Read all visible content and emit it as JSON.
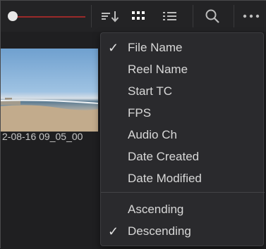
{
  "toolbar": {
    "icons": [
      "sort-icon",
      "grid-view-icon",
      "list-view-icon",
      "search-icon",
      "more-options-icon"
    ]
  },
  "clip": {
    "label": "2-08-16 09_05_00"
  },
  "sort_menu": {
    "fields": [
      {
        "label": "File Name",
        "checked": true
      },
      {
        "label": "Reel Name",
        "checked": false
      },
      {
        "label": "Start TC",
        "checked": false
      },
      {
        "label": "FPS",
        "checked": false
      },
      {
        "label": "Audio Ch",
        "checked": false
      },
      {
        "label": "Date Created",
        "checked": false
      },
      {
        "label": "Date Modified",
        "checked": false
      }
    ],
    "order": [
      {
        "label": "Ascending",
        "checked": false
      },
      {
        "label": "Descending",
        "checked": true
      }
    ],
    "check_glyph": "✓"
  }
}
